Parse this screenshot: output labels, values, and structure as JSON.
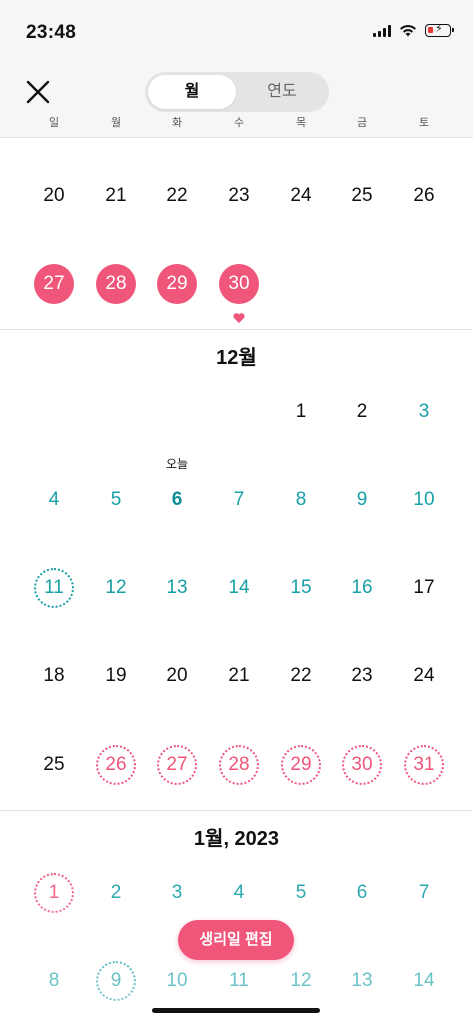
{
  "status": {
    "time": "23:48"
  },
  "header": {
    "tabs": [
      {
        "label": "월",
        "active": true
      },
      {
        "label": "연도",
        "active": false
      }
    ],
    "weekdays": [
      "일",
      "월",
      "화",
      "수",
      "목",
      "금",
      "토"
    ]
  },
  "today_label": "오늘",
  "months": [
    {
      "title": "",
      "weeks": [
        [
          {
            "d": "20",
            "s": "black"
          },
          {
            "d": "21",
            "s": "black"
          },
          {
            "d": "22",
            "s": "black"
          },
          {
            "d": "23",
            "s": "black"
          },
          {
            "d": "24",
            "s": "black"
          },
          {
            "d": "25",
            "s": "black"
          },
          {
            "d": "26",
            "s": "black"
          }
        ],
        [
          {
            "d": "27",
            "s": "period"
          },
          {
            "d": "28",
            "s": "period"
          },
          {
            "d": "29",
            "s": "period"
          },
          {
            "d": "30",
            "s": "period",
            "heart": true
          },
          null,
          null,
          null
        ]
      ]
    },
    {
      "title": "12월",
      "weeks": [
        [
          null,
          null,
          null,
          null,
          {
            "d": "1",
            "s": "black"
          },
          {
            "d": "2",
            "s": "black"
          },
          {
            "d": "3",
            "s": "teal"
          }
        ],
        [
          {
            "d": "4",
            "s": "teal"
          },
          {
            "d": "5",
            "s": "teal"
          },
          {
            "d": "6",
            "s": "today"
          },
          {
            "d": "7",
            "s": "teal"
          },
          {
            "d": "8",
            "s": "teal"
          },
          {
            "d": "9",
            "s": "teal"
          },
          {
            "d": "10",
            "s": "teal"
          }
        ],
        [
          {
            "d": "11",
            "s": "fertile"
          },
          {
            "d": "12",
            "s": "teal"
          },
          {
            "d": "13",
            "s": "teal"
          },
          {
            "d": "14",
            "s": "teal"
          },
          {
            "d": "15",
            "s": "teal"
          },
          {
            "d": "16",
            "s": "teal"
          },
          {
            "d": "17",
            "s": "black"
          }
        ],
        [
          {
            "d": "18",
            "s": "black"
          },
          {
            "d": "19",
            "s": "black"
          },
          {
            "d": "20",
            "s": "black"
          },
          {
            "d": "21",
            "s": "black"
          },
          {
            "d": "22",
            "s": "black"
          },
          {
            "d": "23",
            "s": "black"
          },
          {
            "d": "24",
            "s": "black"
          }
        ],
        [
          {
            "d": "25",
            "s": "black"
          },
          {
            "d": "26",
            "s": "predicted"
          },
          {
            "d": "27",
            "s": "predicted"
          },
          {
            "d": "28",
            "s": "predicted"
          },
          {
            "d": "29",
            "s": "predicted"
          },
          {
            "d": "30",
            "s": "predicted"
          },
          {
            "d": "31",
            "s": "predicted"
          }
        ]
      ]
    },
    {
      "title": "1월, 2023",
      "weeks": [
        [
          {
            "d": "1",
            "s": "predicted"
          },
          {
            "d": "2",
            "s": "teal"
          },
          {
            "d": "3",
            "s": "teal"
          },
          {
            "d": "4",
            "s": "teal"
          },
          {
            "d": "5",
            "s": "teal"
          },
          {
            "d": "6",
            "s": "teal"
          },
          {
            "d": "7",
            "s": "teal"
          }
        ],
        [
          {
            "d": "8",
            "s": "teal"
          },
          {
            "d": "9",
            "s": "fertile"
          },
          {
            "d": "10",
            "s": "teal"
          },
          {
            "d": "11",
            "s": "teal"
          },
          {
            "d": "12",
            "s": "teal"
          },
          {
            "d": "13",
            "s": "teal"
          },
          {
            "d": "14",
            "s": "teal"
          }
        ]
      ]
    }
  ],
  "edit_button": "생리일 편집",
  "colors": {
    "period": "#f0557a",
    "fertile": "#16a0a6",
    "text": "#111111"
  }
}
